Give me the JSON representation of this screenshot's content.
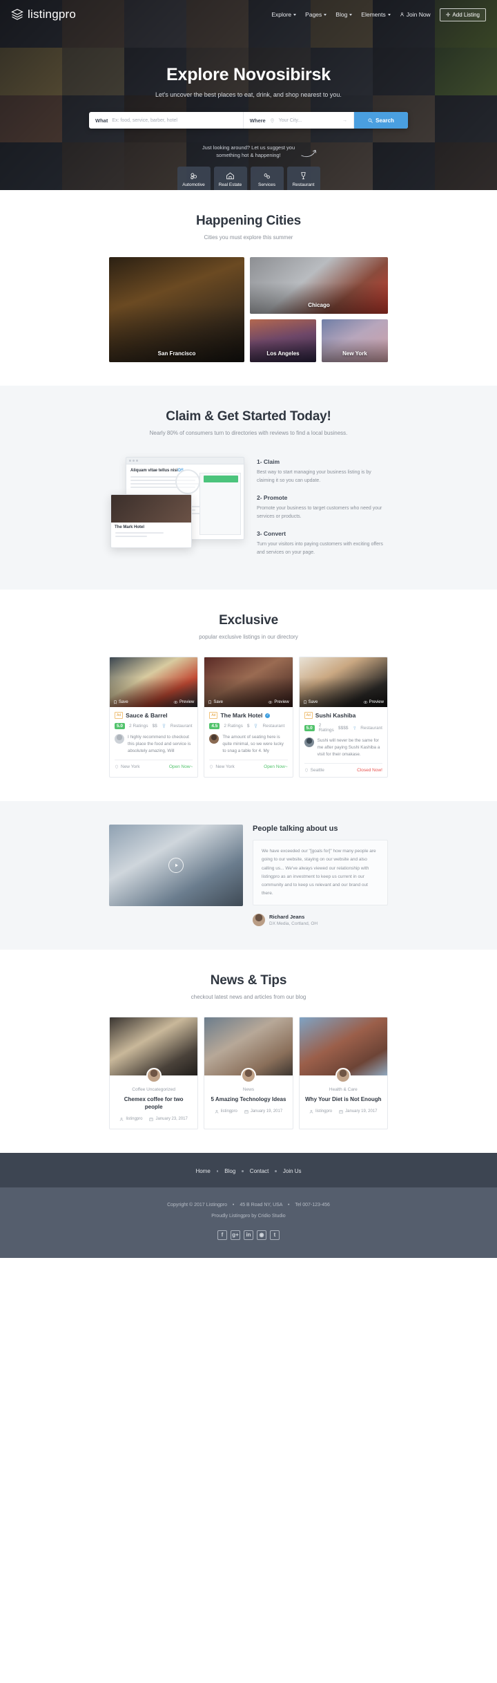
{
  "header": {
    "brand": "listingpro",
    "brand_icon": "layers-icon",
    "nav": [
      {
        "label": "Explore",
        "has_caret": true
      },
      {
        "label": "Pages",
        "has_caret": true
      },
      {
        "label": "Blog",
        "has_caret": true
      },
      {
        "label": "Elements",
        "has_caret": true
      }
    ],
    "join_label": "Join Now",
    "join_icon": "user-icon",
    "add_listing_label": "Add Listing",
    "add_listing_icon": "plus-icon"
  },
  "hero": {
    "title": "Explore Novosibirsk",
    "subtitle": "Let's uncover the best places to eat, drink, and shop nearest to you.",
    "search": {
      "what_label": "What",
      "what_placeholder": "Ex: food, service, barber, hotel",
      "where_label": "Where",
      "where_placeholder": "Your City...",
      "where_icon": "location-icon",
      "button_label": "Search",
      "button_icon": "search-icon",
      "button_color": "#4a9fe0"
    },
    "suggest_line1": "Just looking around? Let us suggest you",
    "suggest_line2": "something hot & happening!",
    "categories": [
      {
        "label": "Automotive",
        "icon": "gears-icon"
      },
      {
        "label": "Real Estate",
        "icon": "house-icon"
      },
      {
        "label": "Services",
        "icon": "cogs-icon"
      },
      {
        "label": "Restaurant",
        "icon": "wine-glass-icon"
      }
    ]
  },
  "cities": {
    "title": "Happening Cities",
    "subtitle": "Cities you must explore this summer",
    "items": [
      {
        "name": "San Francisco"
      },
      {
        "name": "Chicago"
      },
      {
        "name": "Los Angeles"
      },
      {
        "name": "New York"
      }
    ]
  },
  "claim": {
    "title": "Claim & Get Started Today!",
    "subtitle": "Nearly 80% of consumers turn to directories with reviews to find a local business.",
    "mockup": {
      "headline": "Aliquam vitae tellus nisi",
      "headline_accent": "OS",
      "card_title": "The Mark Hotel"
    },
    "steps": [
      {
        "title": "1- Claim",
        "desc": "Best way to start managing your business listing is by claiming it so you can update."
      },
      {
        "title": "2- Promote",
        "desc": "Promote your business to target customers who need your services or products."
      },
      {
        "title": "3- Convert",
        "desc": "Turn your visitors into paying customers with exciting offers and services on your page."
      }
    ]
  },
  "exclusive": {
    "title": "Exclusive",
    "subtitle": "popular exclusive listings in our directory",
    "save_label": "Save",
    "preview_label": "Preview",
    "ad_badge": "Ad",
    "listings": [
      {
        "name": "Sauce & Barrel",
        "verified": false,
        "rating": "5.0",
        "ratings_count": "2 Ratings",
        "price": "$$",
        "category": "Restaurant",
        "review": "I highly recommend to checkout this place the food and service is absolutely amazing, Will",
        "location": "New York",
        "status": "Open Now~",
        "status_state": "open"
      },
      {
        "name": "The Mark Hotel",
        "verified": true,
        "rating": "4.5",
        "ratings_count": "2 Ratings",
        "price": "$",
        "category": "Restaurant",
        "review": "The amount of seating here is quite minimal, so we were lucky to snag a table for 4. My",
        "location": "New York",
        "status": "Open Now~",
        "status_state": "open"
      },
      {
        "name": "Sushi Kashiba",
        "verified": false,
        "rating": "5.0",
        "ratings_count": "2 Ratings",
        "price": "$$$$",
        "category": "Restaurant",
        "review": "Sushi will never be the same for me after paying Sushi Kashiba a visit for their omakase.",
        "location": "Seattle",
        "status": "Closed Now!",
        "status_state": "closed"
      }
    ]
  },
  "testimonial": {
    "title": "People talking about us",
    "quote": "We have exceeded our \"[goals for]\" how many people are going to our website, staying on our website and also calling us... We've always viewed our relationship with listingpro as an investment to keep us current in our community and to keep us relevant and our brand out there.",
    "author_name": "Richard Jeans",
    "author_role": "DX Media, Cortland, OH"
  },
  "news": {
    "title": "News & Tips",
    "subtitle": "checkout latest news and articles from our blog",
    "posts": [
      {
        "category": "Coffee Uncategorized",
        "title": "Chemex coffee for two people",
        "author": "listingpro",
        "date": "January 23, 2017"
      },
      {
        "category": "News",
        "title": "5 Amazing Technology Ideas",
        "author": "listingpro",
        "date": "January 19, 2017"
      },
      {
        "category": "Health & Care",
        "title": "Why Your Diet is Not Enough",
        "author": "listingpro",
        "date": "January 19, 2017"
      }
    ],
    "author_icon": "user-icon",
    "date_icon": "calendar-icon"
  },
  "footer": {
    "links": [
      "Home",
      "Blog",
      "Contact",
      "Join Us"
    ],
    "copyright": "Copyright © 2017 Listingpro",
    "address": "45 B Road NY, USA",
    "phone": "Tel 007-123-456",
    "credit": "Proudly Listingpro by Cridio Studio",
    "socials": [
      {
        "name": "facebook-icon",
        "glyph": "f"
      },
      {
        "name": "google-plus-icon",
        "glyph": "g+"
      },
      {
        "name": "linkedin-icon",
        "glyph": "in"
      },
      {
        "name": "instagram-icon",
        "glyph": "◉"
      },
      {
        "name": "tumblr-icon",
        "glyph": "t"
      }
    ]
  }
}
